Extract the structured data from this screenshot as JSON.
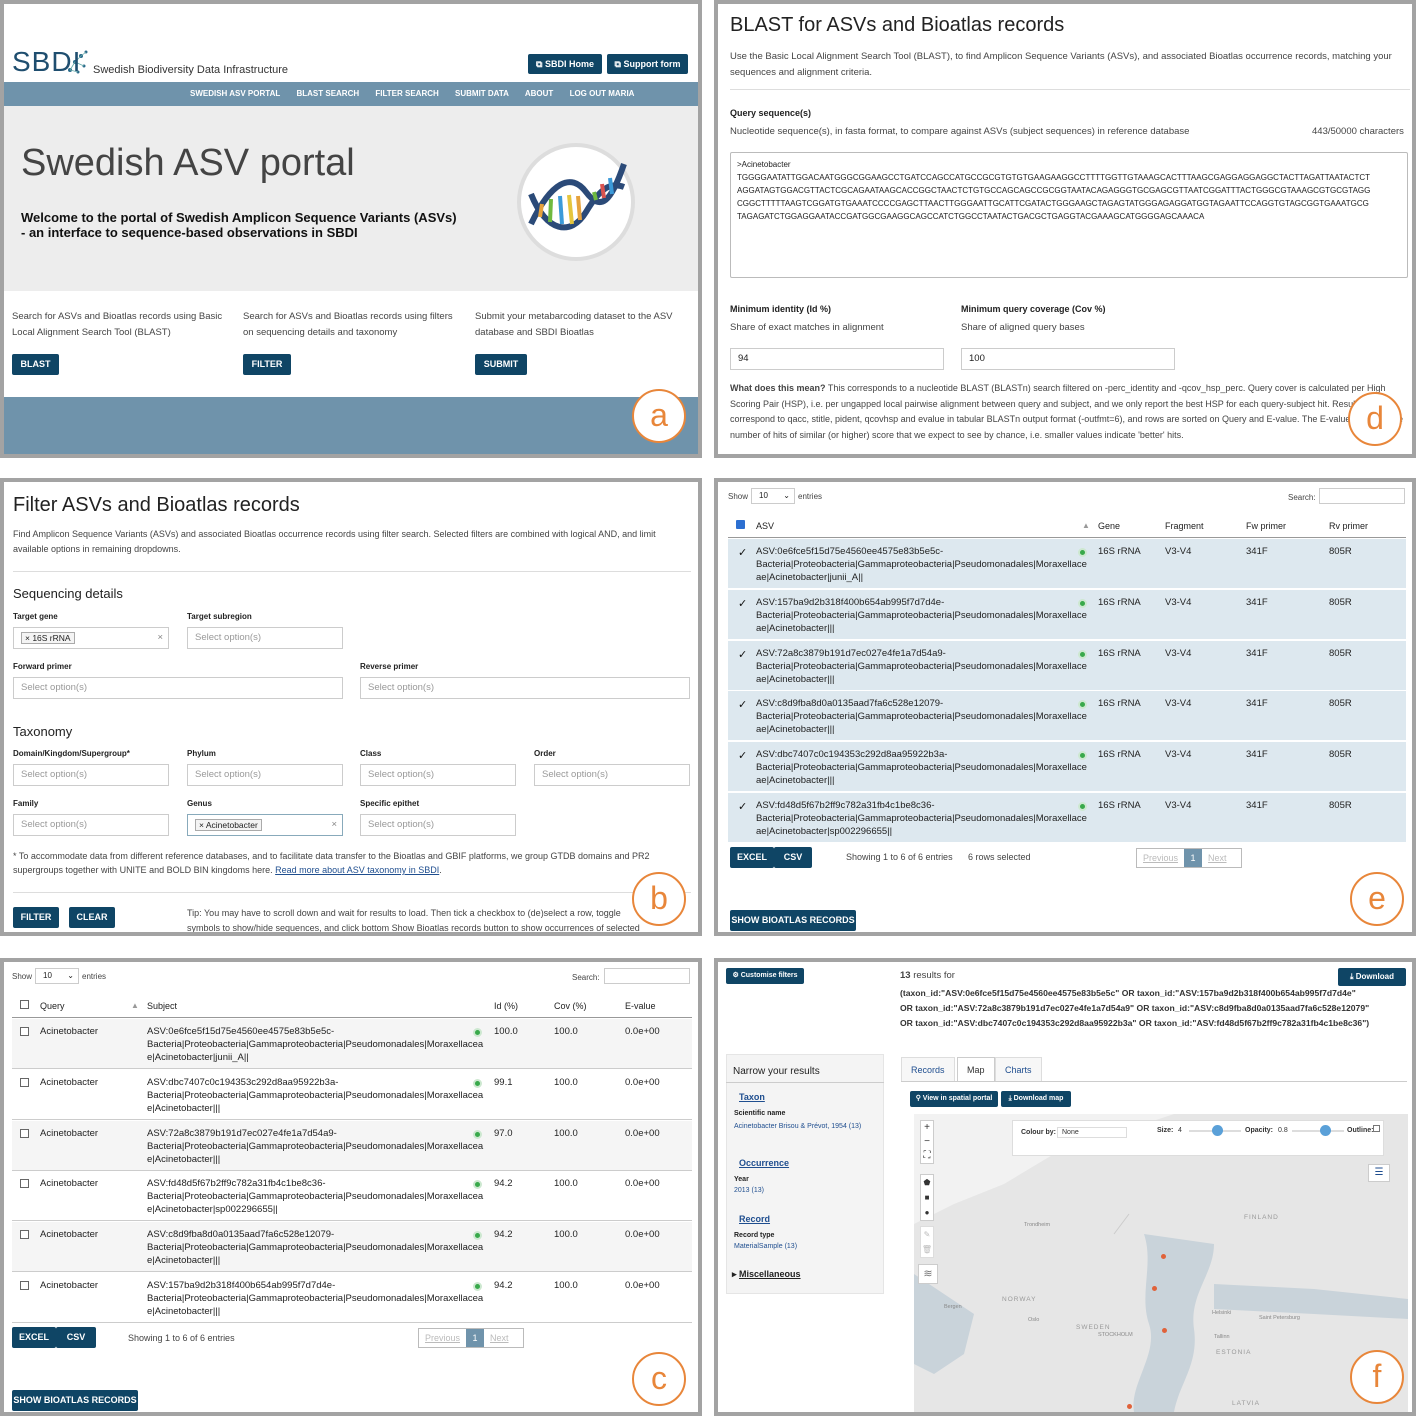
{
  "a": {
    "logo": "SBDI",
    "logo_sub": "Swedish Biodiversity Data Infrastructure",
    "btn_home": "SBDI Home",
    "btn_support": "Support form",
    "nav": [
      "SWEDISH ASV PORTAL",
      "BLAST SEARCH",
      "FILTER SEARCH",
      "SUBMIT DATA",
      "ABOUT",
      "LOG OUT MARIA"
    ],
    "title": "Swedish ASV portal",
    "welcome": "Welcome to the portal of Swedish Amplicon Sequence Variants (ASVs) - an interface to sequence-based observations in SBDI",
    "col1": "Search for ASVs and Bioatlas records using Basic Local Alignment Search Tool (BLAST)",
    "col2": "Search for ASVs and Bioatlas records using filters on sequencing details and taxonomy",
    "col3": "Submit your metabarcoding dataset to the ASV database and SBDI Bioatlas",
    "b1": "BLAST",
    "b2": "FILTER",
    "b3": "SUBMIT",
    "badge": "a"
  },
  "d": {
    "title": "BLAST for ASVs and Bioatlas records",
    "intro": "Use the Basic Local Alignment Search Tool (BLAST), to find Amplicon Sequence Variants (ASVs), and associated Bioatlas occurrence records, matching your sequences and alignment criteria.",
    "query_label": "Query sequence(s)",
    "query_help": "Nucleotide sequence(s), in fasta format, to compare against ASVs (subject sequences) in reference database",
    "char_count": "443/50000 characters",
    "seq_header": ">Acinetobacter",
    "seq_lines": [
      "TGGGGAATATTGGACAATGGGCGGAAGCCTGATCCAGCCATGCCGCGTGTGTGAAGAAGGCCTTTTGGTTGTAAAGCACTTTAAGCGAGGAGGAGGCTACTTAGATTAATACTCT",
      "AGGATAGTGGACGTTACTCGCAGAATAAGCACCGGCTAACTCTGTGCCAGCAGCCGCGGTAATACAGAGGGTGCGAGCGTTAATCGGATTTACTGGGCGTAAAGCGTGCGTAGG",
      "CGGCTTTTTAAGTCGGATGTGAAATCCCCGAGCTTAACTTGGGAATTGCATTCGATACTGGGAAGCTAGAGTATGGGAGAGGATGGTAGAATTCCAGGTGTAGCGGTGAAATGCG",
      "TAGAGATCTGGAGGAATACCGATGGCGAAGGCAGCCATCTGGCCTAATACTGACGCTGAGGTACGAAAGCATGGGGAGCAAACA"
    ],
    "min_id_label": "Minimum identity (Id %)",
    "min_id_help": "Share of exact matches in alignment",
    "min_id": "94",
    "min_cov_label": "Minimum query coverage (Cov %)",
    "min_cov_help": "Share of aligned query bases",
    "min_cov": "100",
    "explain_bold": "What does this mean?",
    "explain": "This corresponds to a nucleotide BLAST (BLASTn) search filtered on -perc_identity and -qcov_hsp_perc. Query cover is calculated per High Scoring Pair (HSP), i.e. per ungapped local pairwise alignment between query and subject, and we only report the best HSP for each query-subject hit. Result fields correspond to qacc, stitle, pident, qcovhsp and evalue in tabular BLASTn output format (-outfmt=6), and rows are sorted on Query and E-value. The E-value specifies the number of hits of similar (or higher) score that we expect to see by chance, i.e. smaller values indicate 'better' hits.",
    "badge": "d"
  },
  "b": {
    "title": "Filter ASVs and Bioatlas records",
    "intro": "Find Amplicon Sequence Variants (ASVs) and associated Bioatlas occurrence records using filter search. Selected filters are combined with logical AND, and limit available options in remaining dropdowns.",
    "seq_heading": "Sequencing details",
    "target_gene": "Target gene",
    "gene_tag": "× 16S rRNA",
    "target_sub": "Target subregion",
    "placeholder": "Select option(s)",
    "fw": "Forward primer",
    "rv": "Reverse primer",
    "tax_heading": "Taxonomy",
    "domain": "Domain/Kingdom/Supergroup*",
    "phylum": "Phylum",
    "class": "Class",
    "order": "Order",
    "family": "Family",
    "genus": "Genus",
    "genus_tag": "× Acinetobacter",
    "epithet": "Specific epithet",
    "footnote": "* To accommodate data from different reference databases, and to facilitate data transfer to the Bioatlas and GBIF platforms, we group GTDB domains and PR2 supergroups together with UNITE and BOLD BIN kingdoms here.",
    "footnote_link": "Read more about ASV taxonomy in SBDI",
    "btn_filter": "FILTER",
    "btn_clear": "CLEAR",
    "tip": "Tip: You may have to scroll down and wait for results to load. Then tick a checkbox to (de)select a row, toggle symbols to show/hide sequences, and click bottom Show Bioatlas records button to show occurrences of selected",
    "badge": "b"
  },
  "e": {
    "show": "Show",
    "entries_val": "10",
    "entries": "entries",
    "search": "Search:",
    "headers": [
      "ASV",
      "Gene",
      "Fragment",
      "Fw primer",
      "Rv primer"
    ],
    "rows": [
      {
        "asv": "ASV:0e6fce5f15d75e4560ee4575e83b5e5c-",
        "tax1": "Bacteria|Proteobacteria|Gammaproteobacteria|Pseudomonadales|Moraxellace",
        "tax2": "ae|Acinetobacter|junii_A||",
        "gene": "16S rRNA",
        "frag": "V3-V4",
        "fw": "341F",
        "rv": "805R"
      },
      {
        "asv": "ASV:157ba9d2b318f400b654ab995f7d7d4e-",
        "tax1": "Bacteria|Proteobacteria|Gammaproteobacteria|Pseudomonadales|Moraxellace",
        "tax2": "ae|Acinetobacter|||",
        "gene": "16S rRNA",
        "frag": "V3-V4",
        "fw": "341F",
        "rv": "805R"
      },
      {
        "asv": "ASV:72a8c3879b191d7ec027e4fe1a7d54a9-",
        "tax1": "Bacteria|Proteobacteria|Gammaproteobacteria|Pseudomonadales|Moraxellace",
        "tax2": "ae|Acinetobacter|||",
        "gene": "16S rRNA",
        "frag": "V3-V4",
        "fw": "341F",
        "rv": "805R"
      },
      {
        "asv": "ASV:c8d9fba8d0a0135aad7fa6c528e12079-",
        "tax1": "Bacteria|Proteobacteria|Gammaproteobacteria|Pseudomonadales|Moraxellace",
        "tax2": "ae|Acinetobacter|||",
        "gene": "16S rRNA",
        "frag": "V3-V4",
        "fw": "341F",
        "rv": "805R"
      },
      {
        "asv": "ASV:dbc7407c0c194353c292d8aa95922b3a-",
        "tax1": "Bacteria|Proteobacteria|Gammaproteobacteria|Pseudomonadales|Moraxellace",
        "tax2": "ae|Acinetobacter|||",
        "gene": "16S rRNA",
        "frag": "V3-V4",
        "fw": "341F",
        "rv": "805R"
      },
      {
        "asv": "ASV:fd48d5f67b2ff9c782a31fb4c1be8c36-",
        "tax1": "Bacteria|Proteobacteria|Gammaproteobacteria|Pseudomonadales|Moraxellace",
        "tax2": "ae|Acinetobacter|sp002296655||",
        "gene": "16S rRNA",
        "frag": "V3-V4",
        "fw": "341F",
        "rv": "805R"
      }
    ],
    "excel": "EXCEL",
    "csv": "CSV",
    "showing": "Showing 1 to 6 of 6 entries",
    "selected": "6 rows selected",
    "prev": "Previous",
    "page": "1",
    "next": "Next",
    "bioatlas": "SHOW BIOATLAS RECORDS",
    "badge": "e"
  },
  "c": {
    "show": "Show",
    "entries_val": "10",
    "entries": "entries",
    "search": "Search:",
    "headers": [
      "Query",
      "Subject",
      "Id (%)",
      "Cov (%)",
      "E-value"
    ],
    "rows": [
      {
        "q": "Acinetobacter",
        "asv": "ASV:0e6fce5f15d75e4560ee4575e83b5e5c-",
        "tax1": "Bacteria|Proteobacteria|Gammaproteobacteria|Pseudomonadales|Moraxellacea",
        "tax2": "e|Acinetobacter|junii_A||",
        "id": "100.0",
        "cov": "100.0",
        "ev": "0.0e+00"
      },
      {
        "q": "Acinetobacter",
        "asv": "ASV:dbc7407c0c194353c292d8aa95922b3a-",
        "tax1": "Bacteria|Proteobacteria|Gammaproteobacteria|Pseudomonadales|Moraxellacea",
        "tax2": "e|Acinetobacter|||",
        "id": "99.1",
        "cov": "100.0",
        "ev": "0.0e+00"
      },
      {
        "q": "Acinetobacter",
        "asv": "ASV:72a8c3879b191d7ec027e4fe1a7d54a9-",
        "tax1": "Bacteria|Proteobacteria|Gammaproteobacteria|Pseudomonadales|Moraxellacea",
        "tax2": "e|Acinetobacter|||",
        "id": "97.0",
        "cov": "100.0",
        "ev": "0.0e+00"
      },
      {
        "q": "Acinetobacter",
        "asv": "ASV:fd48d5f67b2ff9c782a31fb4c1be8c36-",
        "tax1": "Bacteria|Proteobacteria|Gammaproteobacteria|Pseudomonadales|Moraxellacea",
        "tax2": "e|Acinetobacter|sp002296655||",
        "id": "94.2",
        "cov": "100.0",
        "ev": "0.0e+00"
      },
      {
        "q": "Acinetobacter",
        "asv": "ASV:c8d9fba8d0a0135aad7fa6c528e12079-",
        "tax1": "Bacteria|Proteobacteria|Gammaproteobacteria|Pseudomonadales|Moraxellacea",
        "tax2": "e|Acinetobacter|||",
        "id": "94.2",
        "cov": "100.0",
        "ev": "0.0e+00"
      },
      {
        "q": "Acinetobacter",
        "asv": "ASV:157ba9d2b318f400b654ab995f7d7d4e-",
        "tax1": "Bacteria|Proteobacteria|Gammaproteobacteria|Pseudomonadales|Moraxellacea",
        "tax2": "e|Acinetobacter|||",
        "id": "94.2",
        "cov": "100.0",
        "ev": "0.0e+00"
      }
    ],
    "excel": "EXCEL",
    "csv": "CSV",
    "showing": "Showing 1 to 6 of 6 entries",
    "prev": "Previous",
    "page": "1",
    "next": "Next",
    "bioatlas": "SHOW BIOATLAS RECORDS",
    "badge": "c"
  },
  "f": {
    "customise": "Customise filters",
    "results_count": "13",
    "results_for": "results for",
    "download": "Download",
    "query_lines": [
      "(taxon_id:\"ASV:0e6fce5f15d75e4560ee4575e83b5e5c\" OR taxon_id:\"ASV:157ba9d2b318f400b654ab995f7d7d4e\"",
      "OR taxon_id:\"ASV:72a8c3879b191d7ec027e4fe1a7d54a9\" OR taxon_id:\"ASV:c8d9fba8d0a0135aad7fa6c528e12079\"",
      "OR taxon_id:\"ASV:dbc7407c0c194353c292d8aa95922b3a\" OR taxon_id:\"ASV:fd48d5f67b2ff9c782a31fb4c1be8c36\")"
    ],
    "narrow": "Narrow your results",
    "taxon": "Taxon",
    "sci_name": "Scientific name",
    "sci_val": "Acinetobacter Brisou & Prévot, 1954 (13)",
    "occurrence": "Occurrence",
    "year": "Year",
    "year_val": "2013 (13)",
    "record": "Record",
    "record_type": "Record type",
    "record_val": "MaterialSample (13)",
    "misc": "Miscellaneous",
    "tabs": [
      "Records",
      "Map",
      "Charts"
    ],
    "view_spatial": "View in spatial portal",
    "download_map": "Download map",
    "colour_by": "Colour by:",
    "colour_val": "None",
    "size": "Size:",
    "size_val": "4",
    "opacity": "Opacity:",
    "opacity_val": "0.8",
    "outline": "Outline:",
    "places": [
      "FINLAND",
      "NORWAY",
      "SWEDEN",
      "STOCKHOLM",
      "Helsinki",
      "Saint Petersburg",
      "Tallinn",
      "ESTONIA",
      "Oslo",
      "Bergen",
      "Trondheim",
      "LATVIA"
    ],
    "badge": "f"
  }
}
